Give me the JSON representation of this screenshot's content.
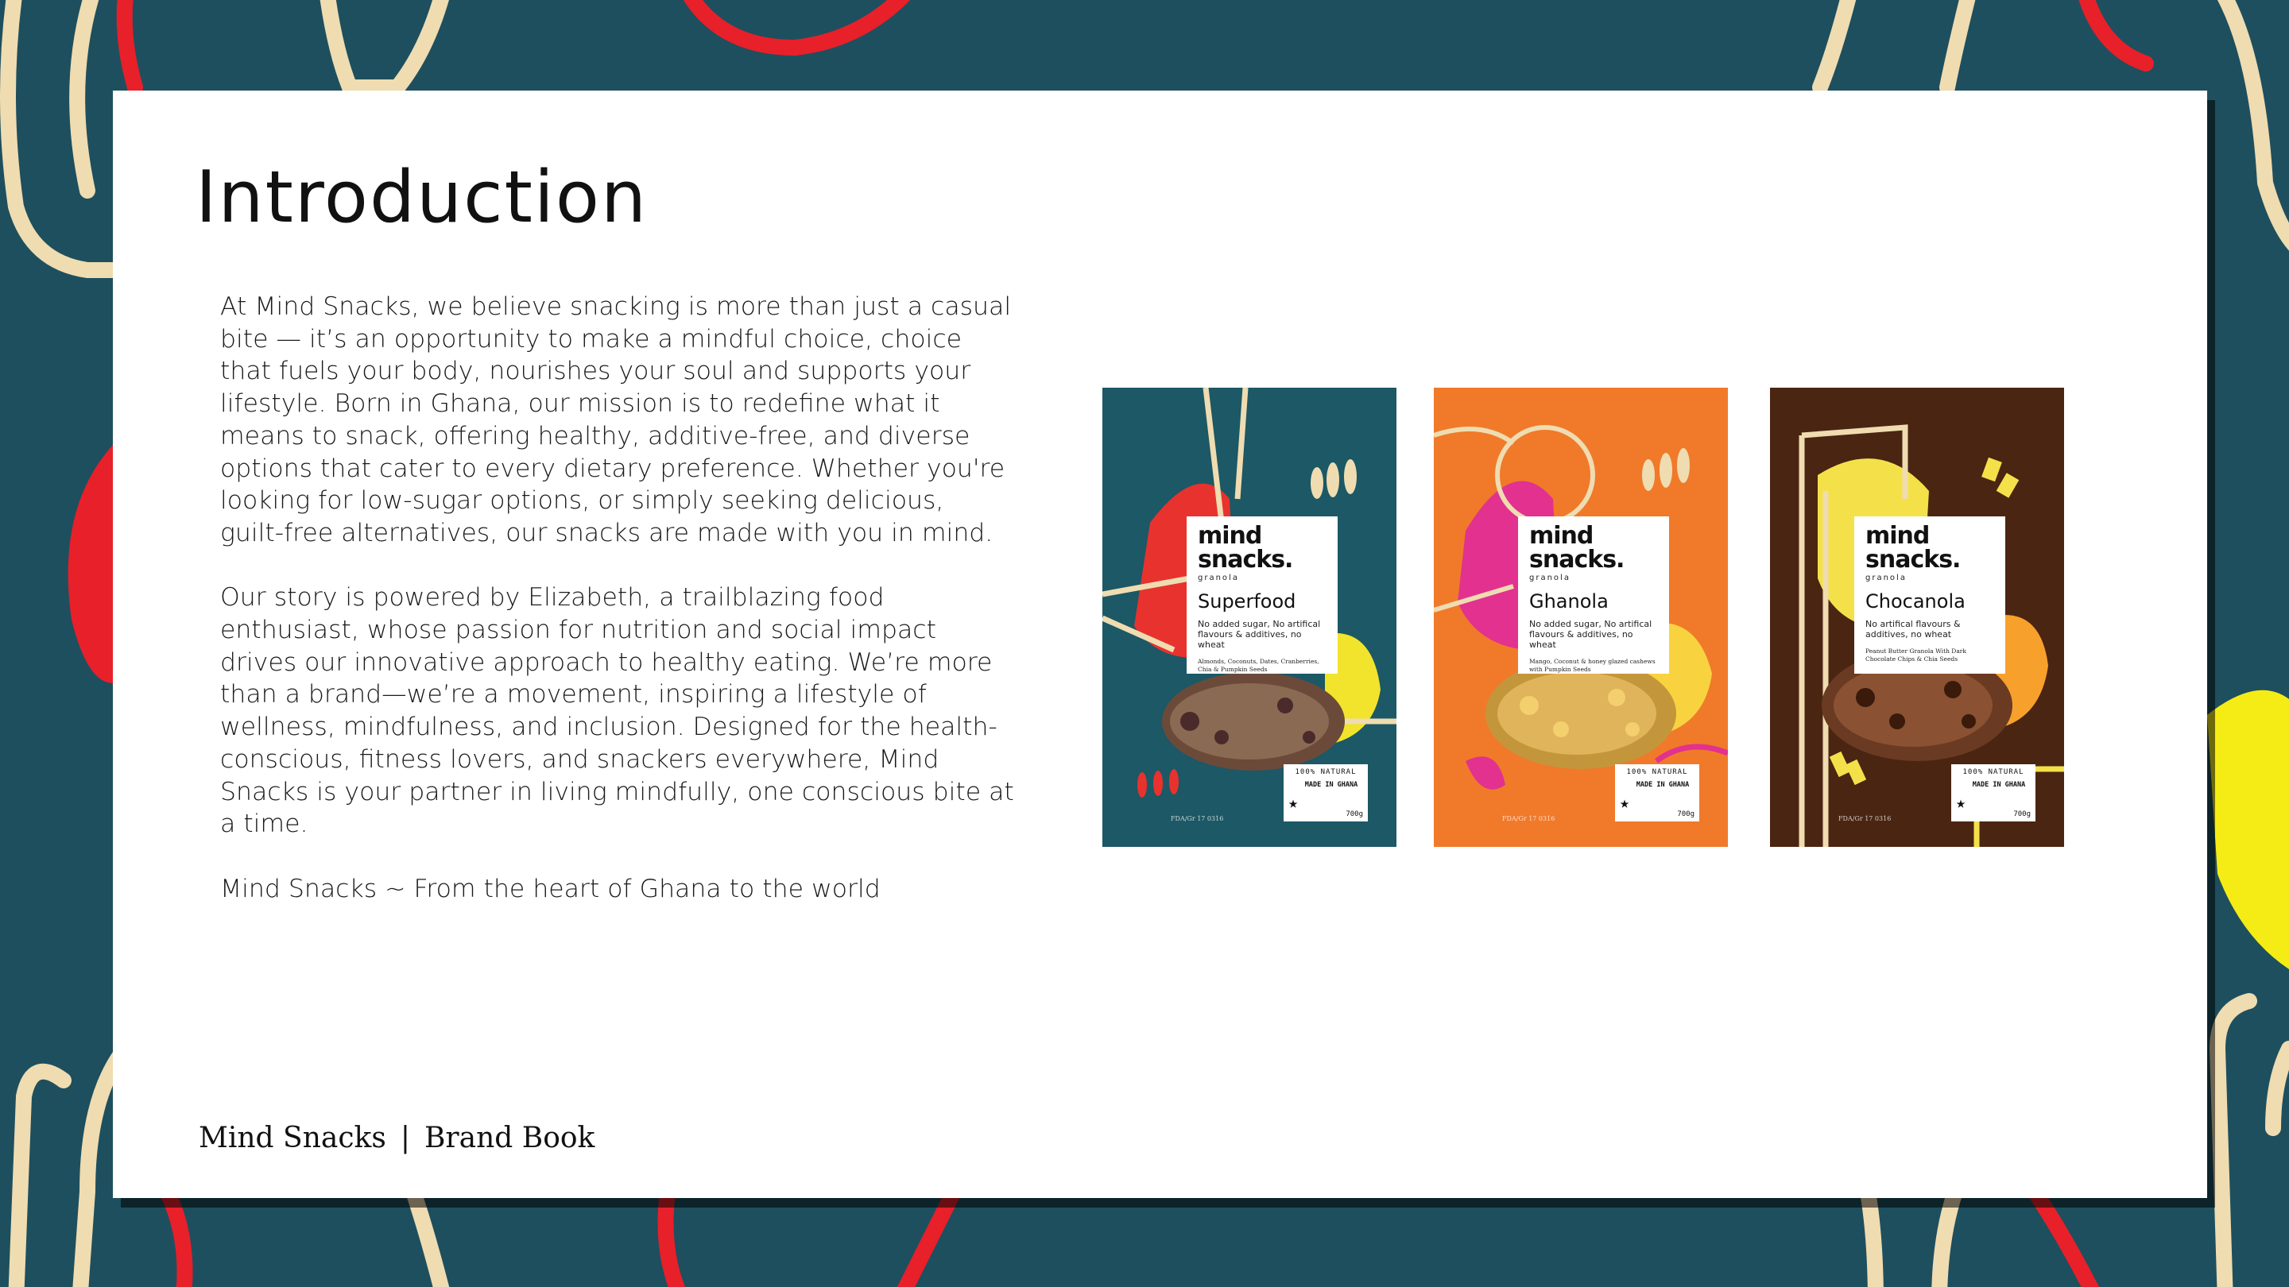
{
  "page": {
    "title": "Introduction",
    "paragraphs": [
      "At Mind Snacks, we believe snacking is more than just a casual bite — it’s an opportunity to make a mindful choice, choice that fuels your body, nourishes your soul and supports your lifestyle. Born in Ghana, our mission is to redefine what it means to snack, offering healthy, additive-free, and diverse options that cater to every dietary preference. Whether you're looking for low-sugar options, or simply seeking delicious, guilt-free alternatives, our snacks are made with you in mind.",
      "Our story is powered by Elizabeth, a trailblazing food enthusiast, whose passion for nutrition and social impact drives our innovative approach to healthy eating. We’re more than a brand—we’re a movement, inspiring a lifestyle of wellness, mindfulness, and inclusion. Designed for the health-conscious, fitness lovers, and snackers everywhere, Mind Snacks is your partner in living mindfully, one conscious bite at a time.",
      "Mind Snacks ~ From the heart of Ghana to the world"
    ]
  },
  "footer": {
    "brand": "Mind Snacks",
    "separator": "|",
    "doc": "Brand Book"
  },
  "products": [
    {
      "brand_line1": "mind",
      "brand_line2": "snacks.",
      "sub": "granola",
      "flavor": "Superfood",
      "desc": "No added sugar, No artifical flavours & additives, no wheat",
      "ingredients": "Almonds, Coconuts, Dates, Cranberries, Chia & Pumpkin Seeds",
      "badge_top": "100% NATURAL",
      "badge_mid": "MADE IN GHANA",
      "weight": "700g",
      "fda": "FDA/Gr 17 0316",
      "colors": {
        "bg": "#1c5865",
        "blob": "#e8322e",
        "accent": "#f2e32c"
      }
    },
    {
      "brand_line1": "mind",
      "brand_line2": "snacks.",
      "sub": "granola",
      "flavor": "Ghanola",
      "desc": "No added sugar, No artifical flavours & additives, no wheat",
      "ingredients": "Mango, Coconut & honey glazed cashews with Pumpkin Seeds",
      "badge_top": "100% NATURAL",
      "badge_mid": "MADE IN GHANA",
      "weight": "700g",
      "fda": "FDA/Gr 17 0316",
      "colors": {
        "bg": "#f07a2a",
        "blob": "#e2318f",
        "accent": "#f9d33f"
      }
    },
    {
      "brand_line1": "mind",
      "brand_line2": "snacks.",
      "sub": "granola",
      "flavor": "Chocanola",
      "desc": "No artifical flavours & additives, no wheat",
      "ingredients": "Peanut Butter Granola With Dark Chocolate Chips & Chia Seeds",
      "badge_top": "100% NATURAL",
      "badge_mid": "MADE IN GHANA",
      "weight": "700g",
      "fda": "FDA/Gr 17 0316",
      "colors": {
        "bg": "#4a2512",
        "blob": "#f4e14a",
        "accent": "#f7a12c"
      }
    }
  ],
  "colors": {
    "background": "#1e4f5e",
    "cream_stroke": "#efdcb1",
    "red_stroke": "#e8202a",
    "yellow": "#f6ec15",
    "card": "#ffffff"
  }
}
